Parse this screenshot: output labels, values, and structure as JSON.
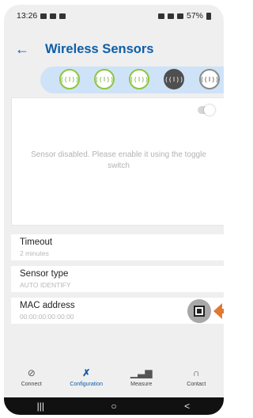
{
  "status_bar": {
    "time": "13:26",
    "signal_text": "57%"
  },
  "header": {
    "back_glyph": "←",
    "title": "Wireless Sensors"
  },
  "sensors": [
    {
      "glyph": "((ǀ))",
      "state": "connected"
    },
    {
      "glyph": "((ǀ))",
      "state": "connected"
    },
    {
      "glyph": "((ǀ))",
      "state": "connected"
    },
    {
      "glyph": "((ǀ))",
      "state": "selected"
    },
    {
      "glyph": "((ǀ))",
      "state": "available"
    }
  ],
  "panel": {
    "toggle_on": false,
    "message": "Sensor disabled. Please enable it using the toggle switch"
  },
  "fields": {
    "timeout": {
      "label": "Timeout",
      "value": "2 minutes"
    },
    "sensor_type": {
      "label": "Sensor type",
      "value": "AUTO IDENTIFY"
    },
    "mac": {
      "label": "MAC address",
      "value": "00:00:00:00:00:00"
    }
  },
  "nav": {
    "connect": {
      "label": "Connect",
      "icon": "link-icon"
    },
    "configuration": {
      "label": "Configuration",
      "icon": "tools-icon",
      "active": true
    },
    "measure": {
      "label": "Measure",
      "icon": "bar-chart-icon"
    },
    "contact": {
      "label": "Contact",
      "icon": "headphones-icon"
    }
  },
  "system_nav": {
    "recents": "|||",
    "home": "○",
    "back": "<"
  },
  "colors": {
    "accent": "#0d5ea8",
    "sensor_green": "#8dc63f",
    "strip": "#cfe3f8",
    "pointer": "#e07832"
  }
}
